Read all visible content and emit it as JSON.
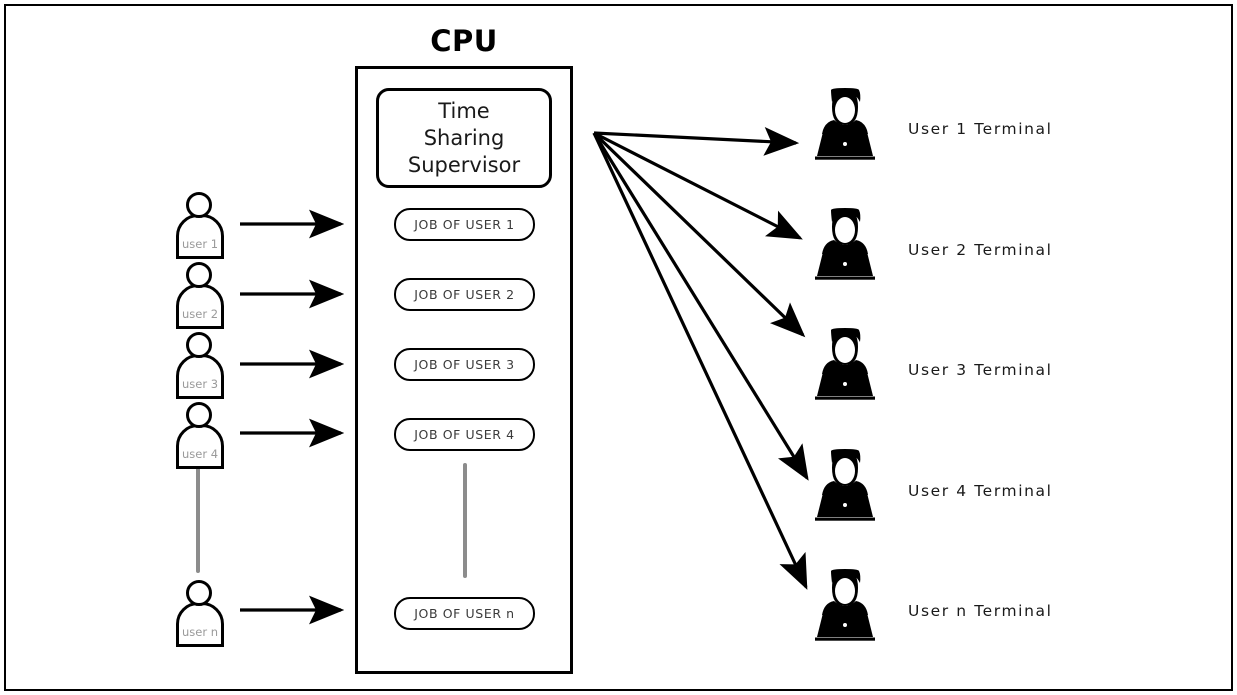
{
  "diagram": {
    "title": "CPU",
    "cpu": {
      "supervisor_label": "Time\nSharing\nSupervisor",
      "jobs": [
        {
          "label": "JOB OF USER 1"
        },
        {
          "label": "JOB OF USER 2"
        },
        {
          "label": "JOB OF USER 3"
        },
        {
          "label": "JOB OF USER 4"
        },
        {
          "label": "JOB OF USER n"
        }
      ]
    },
    "users": [
      {
        "label": "user 1"
      },
      {
        "label": "user 2"
      },
      {
        "label": "user 3"
      },
      {
        "label": "user 4"
      },
      {
        "label": "user n"
      }
    ],
    "terminals": [
      {
        "label": "User 1 Terminal"
      },
      {
        "label": "User 2 Terminal"
      },
      {
        "label": "User 3 Terminal"
      },
      {
        "label": "User 4 Terminal"
      },
      {
        "label": "User n Terminal"
      }
    ],
    "colors": {
      "stroke": "#000000",
      "background": "#ffffff",
      "user_label": "#9a9a9a",
      "job_label": "#3a3a3a",
      "ellipsis_line": "#8c8c8c"
    },
    "icons": {
      "user": "user-outline-icon",
      "terminal": "person-at-laptop-icon",
      "arrow": "arrow-right-icon",
      "ellipsis": "vertical-ellipsis-line"
    }
  }
}
